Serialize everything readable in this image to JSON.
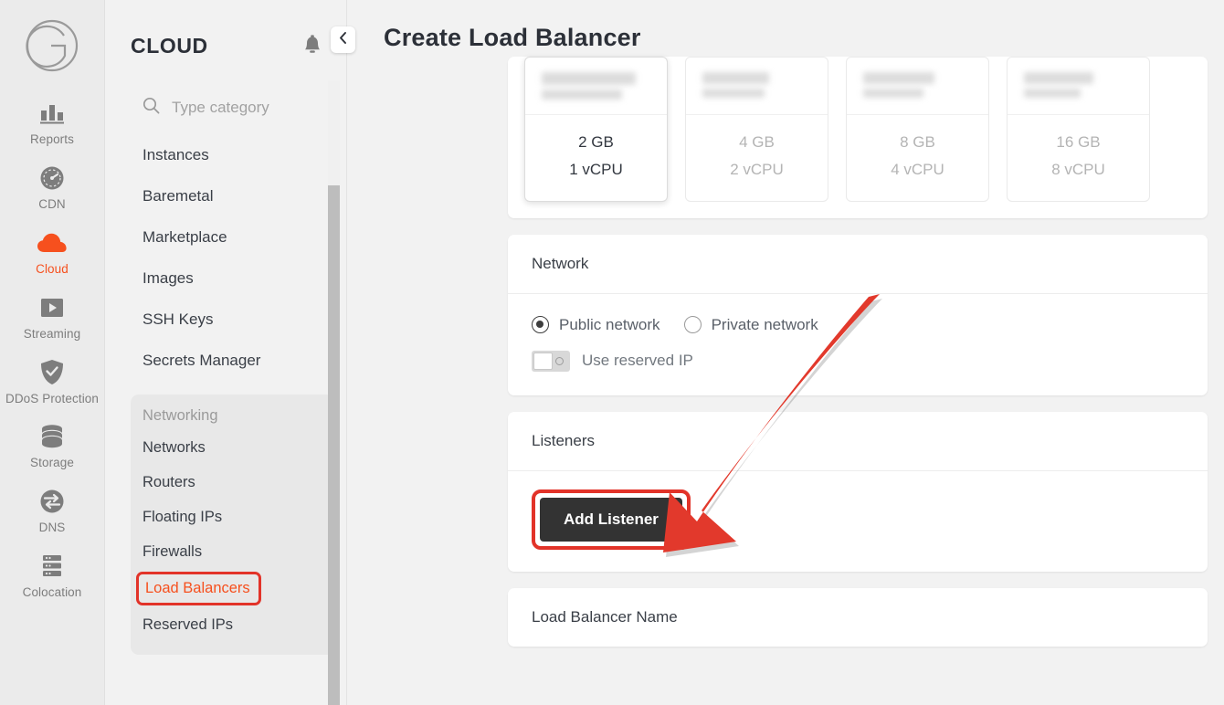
{
  "rail": {
    "logo_icon": "g-logo-icon",
    "items": [
      {
        "label": "Reports",
        "icon": "bar-chart-icon",
        "active": false
      },
      {
        "label": "CDN",
        "icon": "speedometer-icon",
        "active": false
      },
      {
        "label": "Cloud",
        "icon": "cloud-icon",
        "active": true
      },
      {
        "label": "Streaming",
        "icon": "play-video-icon",
        "active": false
      },
      {
        "label": "DDoS Protection",
        "icon": "shield-check-icon",
        "active": false
      },
      {
        "label": "Storage",
        "icon": "database-icon",
        "active": false
      },
      {
        "label": "DNS",
        "icon": "dns-sync-icon",
        "active": false
      },
      {
        "label": "Colocation",
        "icon": "server-rack-icon",
        "active": false
      }
    ]
  },
  "sidebar": {
    "title": "CLOUD",
    "bell_icon": "bell-icon",
    "collapse_icon": "chevron-left-icon",
    "search": {
      "placeholder": "Type category",
      "value": "",
      "icon": "search-icon"
    },
    "items": [
      "Instances",
      "Baremetal",
      "Marketplace",
      "Images",
      "SSH Keys",
      "Secrets Manager"
    ],
    "group": {
      "title": "Networking",
      "items": [
        {
          "label": "Networks",
          "highlighted": false
        },
        {
          "label": "Routers",
          "highlighted": false
        },
        {
          "label": "Floating IPs",
          "highlighted": false
        },
        {
          "label": "Firewalls",
          "highlighted": false
        },
        {
          "label": "Load Balancers",
          "highlighted": true
        },
        {
          "label": "Reserved IPs",
          "highlighted": false
        }
      ]
    }
  },
  "header": {
    "title": "Create Load Balancer"
  },
  "flavors": [
    {
      "ram": "2 GB",
      "cpu": "1 vCPU",
      "price": "",
      "selected": true
    },
    {
      "ram": "4 GB",
      "cpu": "2 vCPU",
      "price": "",
      "selected": false
    },
    {
      "ram": "8 GB",
      "cpu": "4 vCPU",
      "price": "",
      "selected": false
    },
    {
      "ram": "16 GB",
      "cpu": "8 vCPU",
      "price": "",
      "selected": false
    }
  ],
  "network_section": {
    "title": "Network",
    "options": [
      {
        "label": "Public network",
        "selected": true
      },
      {
        "label": "Private network",
        "selected": false
      }
    ],
    "toggle": {
      "label": "Use reserved IP",
      "on": false
    }
  },
  "listeners_section": {
    "title": "Listeners",
    "add_button": "Add Listener"
  },
  "name_section": {
    "title": "Load Balancer Name"
  },
  "annotation": {
    "highlight_color": "#e23329",
    "arrow_color": "#e2392c",
    "accent_color": "#f6501e"
  }
}
